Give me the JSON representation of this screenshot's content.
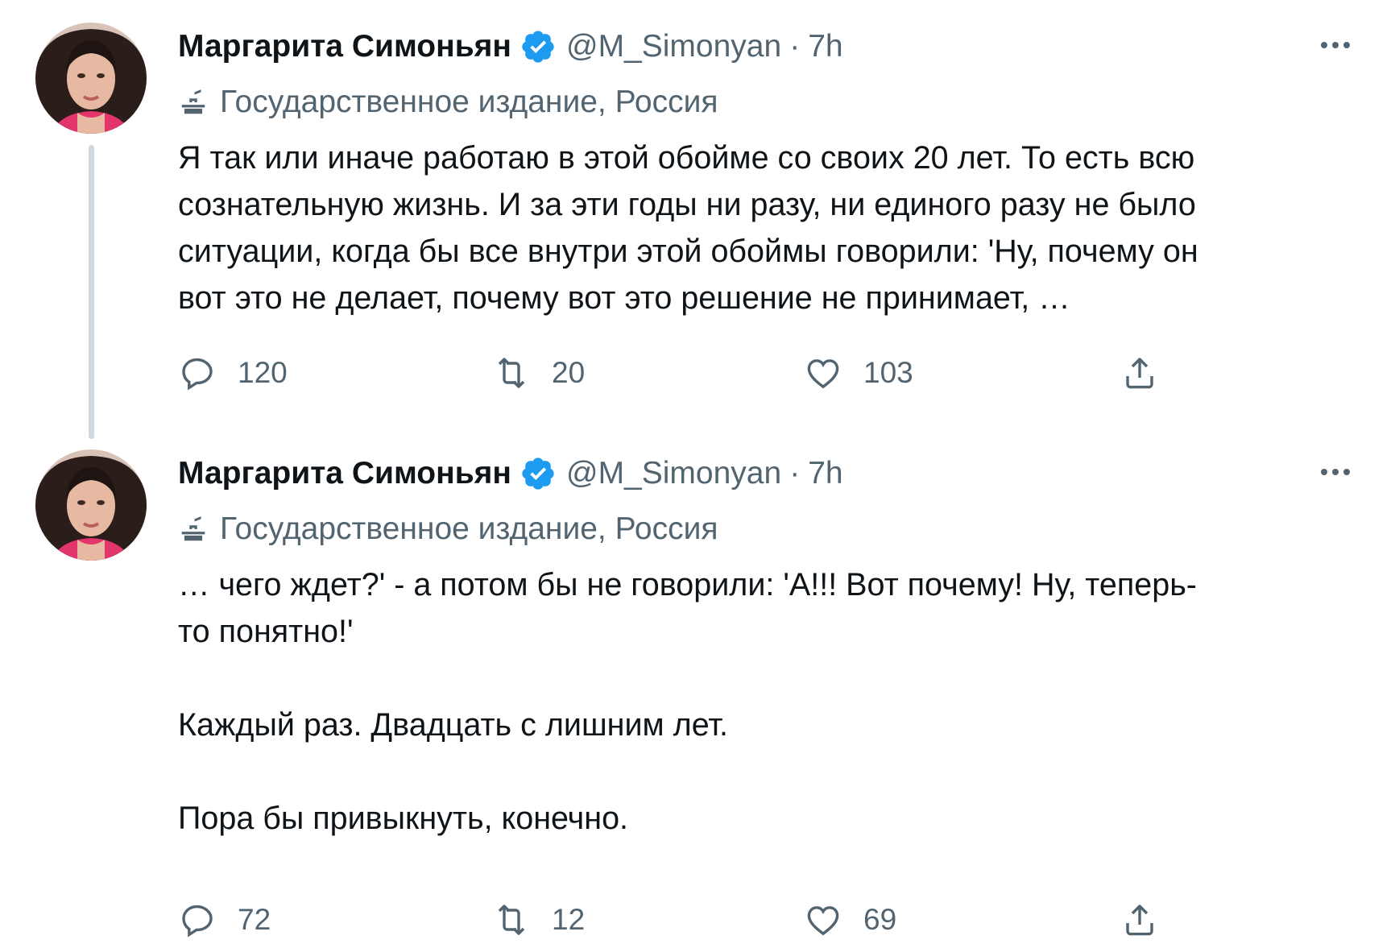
{
  "tweets": [
    {
      "author": {
        "display_name": "Маргарита Симоньян",
        "handle": "@M_Simonyan",
        "verified": true,
        "avatar_icon": "profile-photo"
      },
      "separator": "·",
      "time": "7h",
      "label": "Государственное издание, Россия",
      "body_lines": [
        "Я так или иначе работаю в этой обойме со своих 20 лет. То есть всю",
        "сознательную жизнь. И за эти годы ни разу, ни единого разу не было",
        "ситуации, когда бы все внутри этой обоймы говорили: 'Ну, почему он",
        "вот это не делает, почему вот это решение не принимает, …"
      ],
      "actions": {
        "replies": "120",
        "retweets": "20",
        "likes": "103"
      }
    },
    {
      "author": {
        "display_name": "Маргарита Симоньян",
        "handle": "@M_Simonyan",
        "verified": true,
        "avatar_icon": "profile-photo"
      },
      "separator": "·",
      "time": "7h",
      "label": "Государственное издание, Россия",
      "body_lines": [
        "… чего ждет?' - а потом бы не говорили: 'А!!! Вот почему! Ну, теперь-",
        "то понятно!'",
        "",
        "Каждый раз. Двадцать с лишним лет.",
        "",
        "Пора бы привыкнуть, конечно."
      ],
      "actions": {
        "replies": "72",
        "retweets": "12",
        "likes": "69"
      }
    }
  ],
  "colors": {
    "text_primary": "#0f1419",
    "text_secondary": "#536471",
    "verified_blue": "#1d9bf0",
    "thread_line": "#cfd9de"
  },
  "icons": {
    "more": "more-horizontal-icon",
    "verified": "verified-badge-icon",
    "label": "state-media-podium-icon",
    "reply": "reply-icon",
    "retweet": "retweet-icon",
    "like": "heart-icon",
    "share": "share-icon"
  }
}
